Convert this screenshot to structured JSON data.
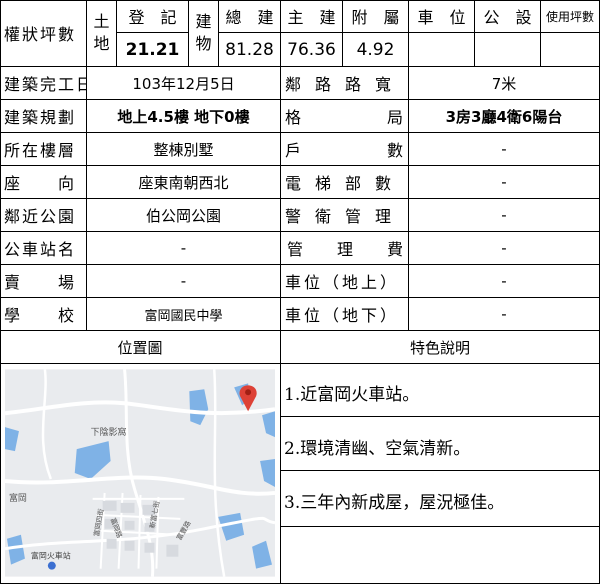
{
  "header": {
    "area_label": "權狀坪數",
    "land_label": "土地",
    "land_sub": "登　記",
    "land_value": "21.21",
    "building_label": "建物",
    "total_building": "總　建",
    "total_building_value": "81.28",
    "main_building": "主　建",
    "main_building_value": "76.36",
    "ancillary": "附　屬",
    "ancillary_value": "4.92",
    "parking": "車　位",
    "parking_value": "",
    "public": "公　設",
    "public_value": "",
    "usable": "使用坪數",
    "usable_value": ""
  },
  "rows": [
    {
      "left_label": "建築完工日",
      "left_value": "103年12月5日",
      "right_label": "鄰路路寬",
      "right_value": "7米"
    },
    {
      "left_label": "建築規劃",
      "left_value": "地上4.5樓 地下0樓",
      "right_label": "格局",
      "right_value": "3房3廳4衛6陽台"
    },
    {
      "left_label": "所在樓層",
      "left_value": "整棟別墅",
      "right_label": "戶數",
      "right_value": "-"
    },
    {
      "left_label": "座向",
      "left_value": "座東南朝西北",
      "right_label": "電梯部數",
      "right_value": "-"
    },
    {
      "left_label": "鄰近公園",
      "left_value": "伯公岡公園",
      "right_label": "警衛管理",
      "right_value": "-"
    },
    {
      "left_label": "公車站名",
      "left_value": "-",
      "right_label": "管理費",
      "right_value": "-"
    },
    {
      "left_label": "賣場",
      "left_value": "-",
      "right_label": "車位（地上）",
      "right_value": "-"
    },
    {
      "left_label": "學校",
      "left_value": "富岡國民中學",
      "right_label": "車位（地下）",
      "right_value": "-"
    }
  ],
  "sections": {
    "map_title": "位置圖",
    "features_title": "特色說明"
  },
  "map": {
    "labels": [
      "下陰影窩",
      "富岡",
      "富岡火車站",
      "富岡四街",
      "新富七街",
      "富岡路",
      "富豐路"
    ]
  },
  "features": [
    "1.近富岡火車站。",
    "2.環境清幽、空氣清新。",
    "3.三年內新成屋，屋況極佳。"
  ],
  "colors": {
    "map_bg": "#e9ebee",
    "water": "#7fb2e6",
    "road": "#ffffff",
    "marker": "#dd4136"
  }
}
